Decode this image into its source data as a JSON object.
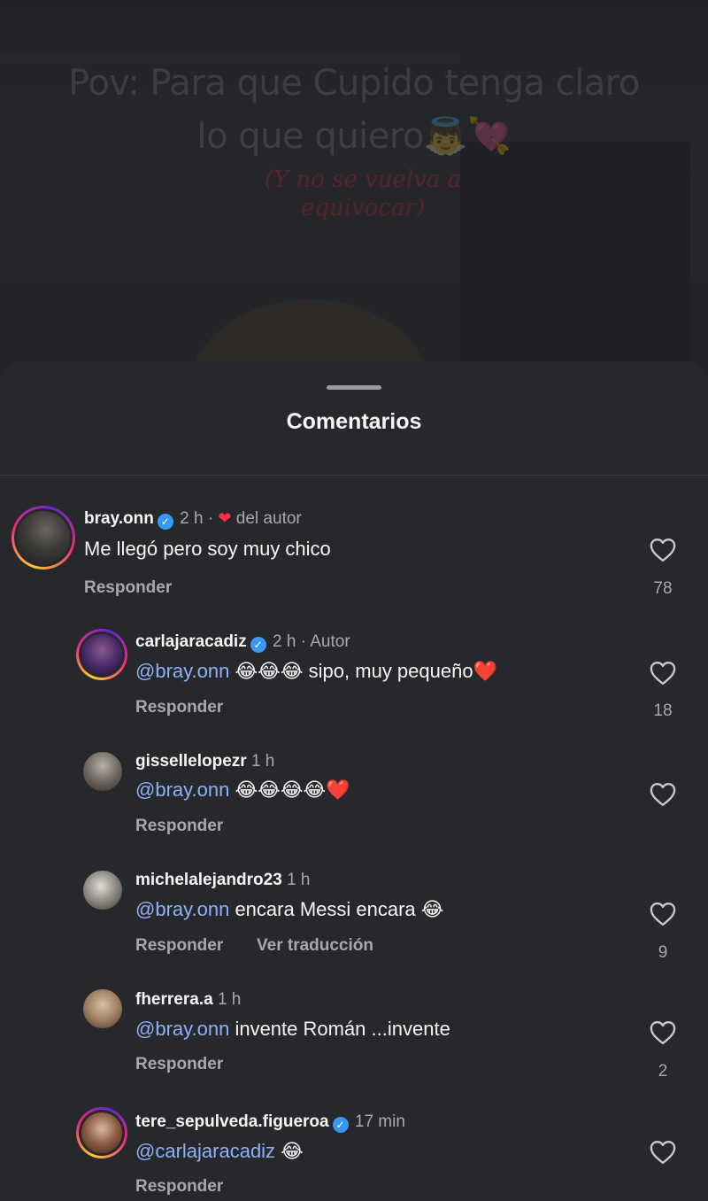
{
  "video": {
    "title_line1": "Pov:  Para que Cupido tenga claro",
    "title_line2": "lo que quiero",
    "title_emoji": "👼💘",
    "subtitle_line1": "(Y no se vuelva a",
    "subtitle_line2": "equivocar)"
  },
  "sheet": {
    "title": "Comentarios"
  },
  "comments": [
    {
      "username": "bray.onn",
      "verified": true,
      "time": "2 h ·",
      "author_like": "del autor",
      "text_mention": "",
      "text": "Me llegó pero soy muy chico",
      "reply": "Responder",
      "likes": "78"
    },
    {
      "username": "carlajaracadiz",
      "verified": true,
      "time": "2 h · Autor",
      "text_mention": "@bray.onn",
      "text": " 😂😂😂 sipo, muy pequeño❤️",
      "reply": "Responder",
      "likes": "18"
    },
    {
      "username": "gissellelopezr",
      "time": "1 h",
      "text_mention": "@bray.onn",
      "text": " 😂😂😂😂❤️",
      "reply": "Responder",
      "likes": ""
    },
    {
      "username": "michelalejandro23",
      "time": "1 h",
      "text_mention": "@bray.onn",
      "text": " encara Messi encara 😂",
      "reply": "Responder",
      "translate": "Ver traducción",
      "likes": "9"
    },
    {
      "username": "fherrera.a",
      "time": "1 h",
      "text_mention": "@bray.onn",
      "text": " invente Román ...invente",
      "reply": "Responder",
      "likes": "2"
    },
    {
      "username": "tere_sepulveda.figueroa",
      "verified": true,
      "time": "17 min",
      "text_mention": "@carlajaracadiz",
      "text": " 😂",
      "reply": "Responder",
      "likes": ""
    }
  ],
  "colors": {
    "sheet_bg": "#26282c",
    "mention": "#8fb2f5",
    "verified": "#3897f0",
    "heart": "#ff3040"
  },
  "icons": {
    "like": "heart-outline-icon",
    "verified": "verified-badge-icon"
  }
}
